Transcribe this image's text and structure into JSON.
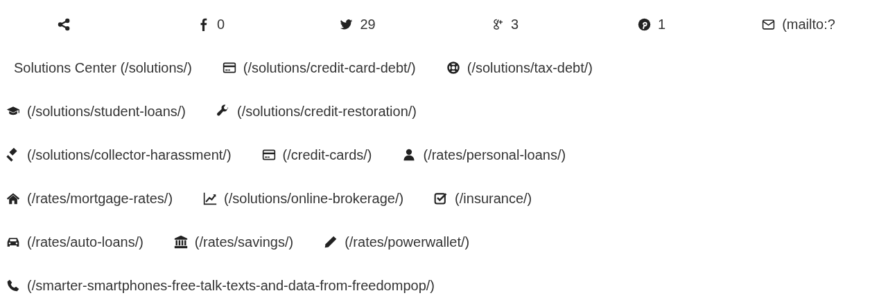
{
  "share_bar": {
    "counts": [
      {
        "count": "0"
      },
      {
        "count": "29"
      },
      {
        "count": "3"
      },
      {
        "count": "1"
      },
      {
        "count": "(mailto:?"
      }
    ]
  },
  "link_rows": [
    {
      "links": [
        {
          "label": "Solutions Center (/solutions/)"
        },
        {
          "label": "(/solutions/credit-card-debt/)"
        },
        {
          "label": "(/solutions/tax-debt/)"
        }
      ]
    },
    {
      "links": [
        {
          "label": "(/solutions/student-loans/)"
        },
        {
          "label": "(/solutions/credit-restoration/)"
        }
      ]
    },
    {
      "links": [
        {
          "label": "(/solutions/collector-harassment/)"
        },
        {
          "label": "(/credit-cards/)"
        },
        {
          "label": "(/rates/personal-loans/)"
        }
      ]
    },
    {
      "links": [
        {
          "label": "(/rates/mortgage-rates/)"
        },
        {
          "label": "(/solutions/online-brokerage/)"
        },
        {
          "label": "(/insurance/)"
        }
      ]
    },
    {
      "links": [
        {
          "label": "(/rates/auto-loans/)"
        },
        {
          "label": "(/rates/savings/)"
        },
        {
          "label": "(/rates/powerwallet/)"
        }
      ]
    },
    {
      "links": [
        {
          "label": "(/smarter-smartphones-free-talk-texts-and-data-from-freedompop/)"
        }
      ]
    }
  ]
}
